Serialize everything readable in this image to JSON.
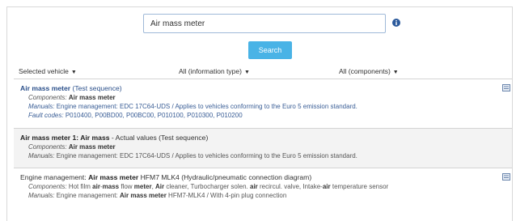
{
  "search": {
    "value": "Air mass meter",
    "button_label": "Search"
  },
  "filters": [
    {
      "label": "Selected vehicle"
    },
    {
      "label": "All (information type)"
    },
    {
      "label": "All (components)"
    }
  ],
  "results": [
    {
      "title_name": "Air mass meter",
      "title_rest": "(Test sequence)",
      "components_label": "Components:",
      "components_value": "Air mass meter",
      "manuals_label": "Manuals:",
      "manuals_value": "Engine management: EDC 17C64-UDS / Applies to vehicles conforming to the Euro 5 emission standard.",
      "faults_label": "Fault codes:",
      "faults_value": "P010400, P00BD00, P00BC00, P010100, P010300, P010200"
    },
    {
      "title_name": "Air mass meter 1: Air mass",
      "title_rest": "- Actual values (Test sequence)",
      "components_label": "Components:",
      "components_value": "Air mass meter",
      "manuals_label": "Manuals:",
      "manuals_value": "Engine management: EDC 17C64-UDS / Applies to vehicles conforming to the Euro 5 emission standard."
    },
    {
      "title_prefix": "Engine management:",
      "title_name": "Air mass meter",
      "title_rest": "HFM7 MLK4 (Hydraulic/pneumatic connection diagram)",
      "components_label": "Components:",
      "components_parts": [
        "Hot film ",
        "air",
        "-",
        "mass",
        " flow ",
        "meter",
        ", ",
        "Air",
        " cleaner, Turbocharger solen. ",
        "air",
        " recircul. valve, Intake-",
        "air",
        " temperature sensor"
      ],
      "manuals_label": "Manuals:",
      "manuals_pre": "Engine management:",
      "manuals_bold": "Air mass meter",
      "manuals_post": "HFM7-MLK4 / With 4-pin plug connection"
    }
  ],
  "colors": {
    "accent": "#49b3e6",
    "link": "#2a4f8a",
    "shaded_row": "#f3f3f3",
    "input_border": "#9fb9d8"
  },
  "icons": [
    "info-icon",
    "document-icon"
  ]
}
